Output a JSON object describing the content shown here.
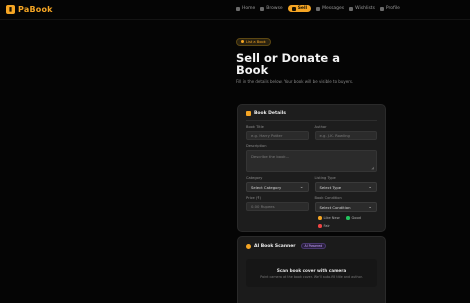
{
  "brand": {
    "name": "PaBook",
    "accent": "#f5a524"
  },
  "nav": {
    "items": [
      {
        "label": "Home",
        "active": false
      },
      {
        "label": "Browse",
        "active": false
      },
      {
        "label": "Sell",
        "active": true
      },
      {
        "label": "Messages",
        "active": false
      },
      {
        "label": "Wishlists",
        "active": false
      },
      {
        "label": "Profile",
        "active": false
      }
    ]
  },
  "hero": {
    "badge": "List a Book",
    "title_line1": "Sell or Donate a",
    "title_line2": "Book",
    "subtitle": "Fill in the details below. Your book will be visible to buyers."
  },
  "form": {
    "heading": "Book Details",
    "title_label": "Book Title",
    "title_placeholder": "e.g. Harry Potter",
    "author_label": "Author",
    "author_placeholder": "e.g. J.K. Rowling",
    "description_label": "Description",
    "description_placeholder": "Describe the book...",
    "category_label": "Category",
    "category_value": "Select Category",
    "listing_type_label": "Listing Type",
    "listing_type_value": "Select Type",
    "price_label": "Price (₹)",
    "price_placeholder": "0.00 Rupees",
    "condition_label": "Book Condition",
    "condition_value": "Select Condition",
    "options": [
      {
        "label": "Like New",
        "color": "#f5a524"
      },
      {
        "label": "Good",
        "color": "#22c55e"
      },
      {
        "label": "Fair",
        "color": "#ef4444"
      }
    ]
  },
  "scanner": {
    "title": "AI Book Scanner",
    "badge": "AI Powered",
    "cta": "Scan book cover with camera",
    "note": "Point camera at the book cover. We'll auto-fill title and author."
  }
}
